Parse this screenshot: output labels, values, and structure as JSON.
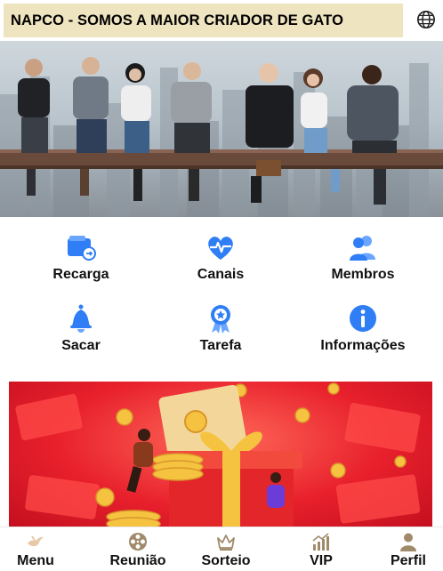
{
  "header": {
    "title": "NAPCO - SOMOS A MAIOR CRIADOR DE GATO",
    "language_icon": "globe-icon"
  },
  "menu_grid": [
    {
      "label": "Recarga",
      "icon": "wallet-icon"
    },
    {
      "label": "Canais",
      "icon": "heart-pulse-icon"
    },
    {
      "label": "Membros",
      "icon": "users-icon"
    },
    {
      "label": "Sacar",
      "icon": "bell-icon"
    },
    {
      "label": "Tarefa",
      "icon": "badge-icon"
    },
    {
      "label": "Informações",
      "icon": "info-icon"
    }
  ],
  "bottom_nav": [
    {
      "label": "Menu",
      "icon": "bird-icon"
    },
    {
      "label": "Reunião",
      "icon": "film-reel-icon"
    },
    {
      "label": "Sorteio",
      "icon": "crown-icon"
    },
    {
      "label": "VIP",
      "icon": "chart-up-icon"
    },
    {
      "label": "Perfil",
      "icon": "person-icon"
    }
  ],
  "colors": {
    "accent_blue": "#2f7ef5",
    "title_bar": "#efe4c0",
    "banner_red": "#e8202c",
    "nav_icon": "#a08a6a"
  }
}
